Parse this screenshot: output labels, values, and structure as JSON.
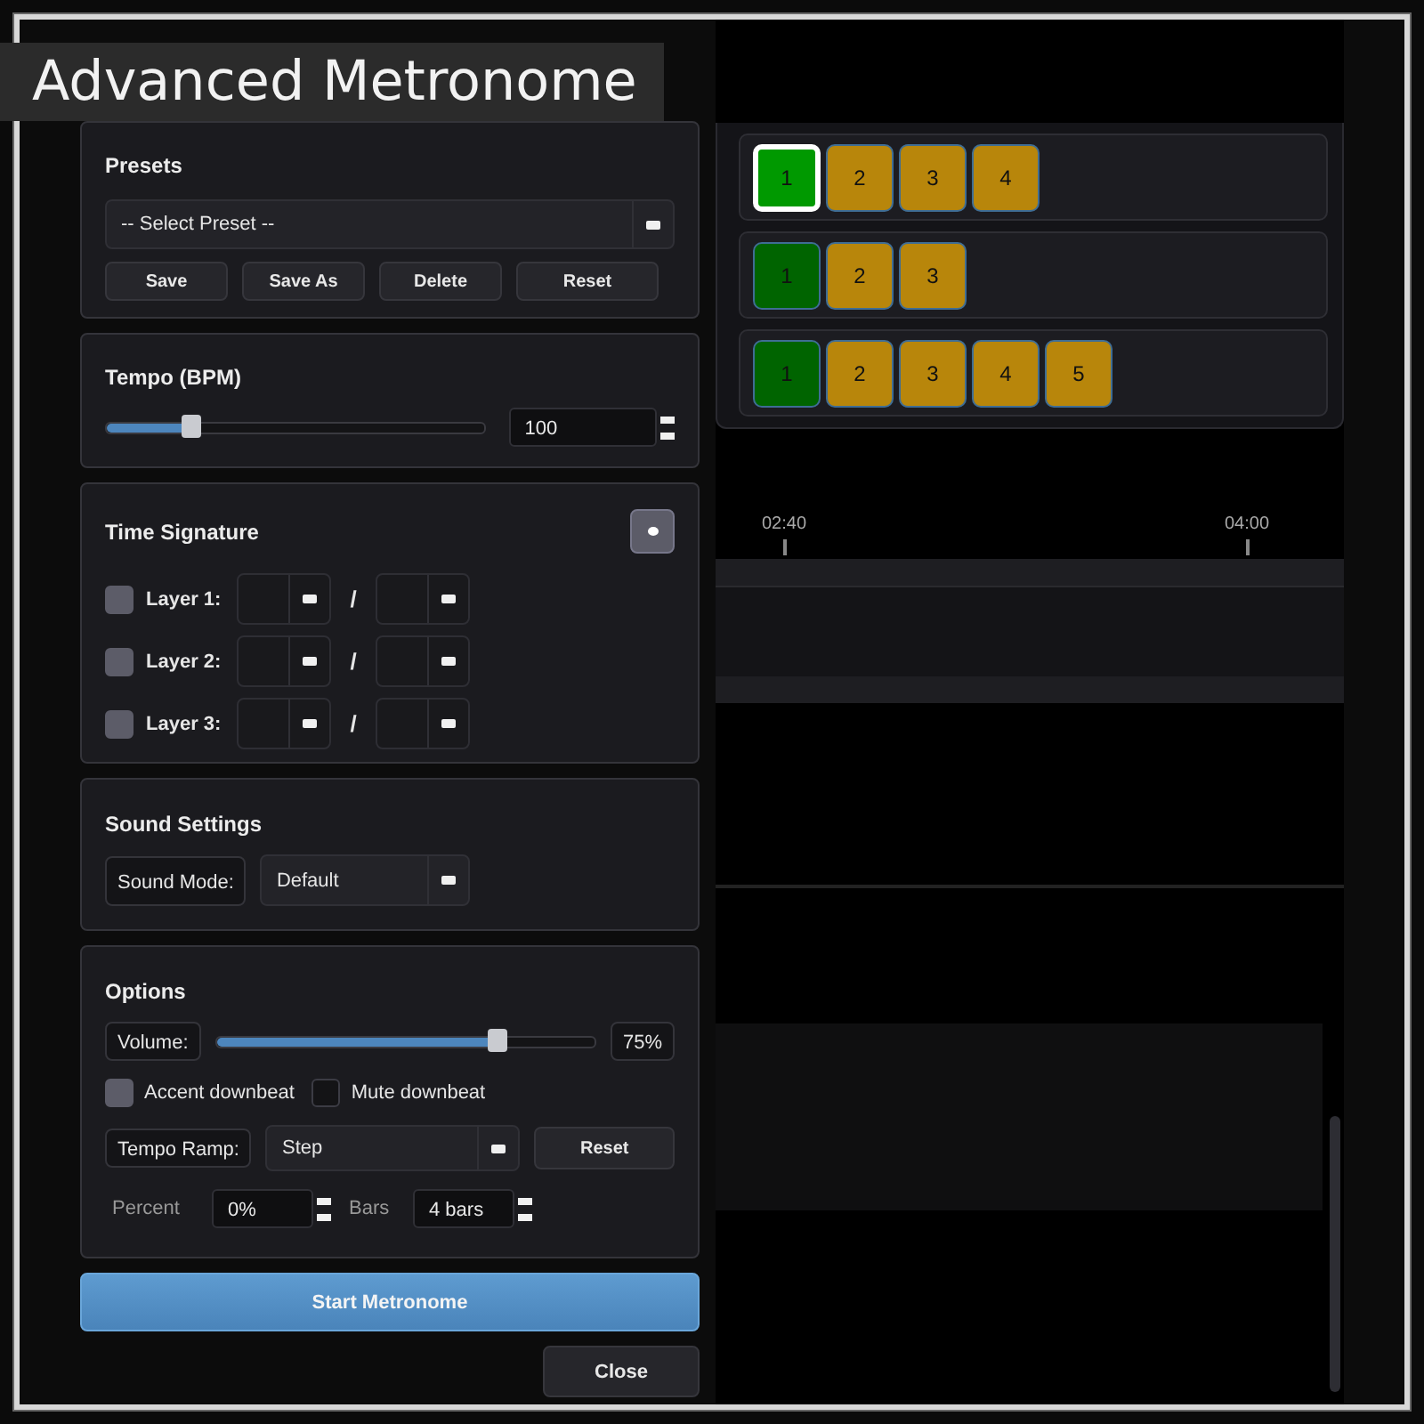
{
  "title": "Advanced Metronome",
  "presets": {
    "heading": "Presets",
    "select_value": "-- Select Preset --",
    "buttons": [
      "Save",
      "Save As",
      "Delete",
      "Reset"
    ]
  },
  "tempo": {
    "heading": "Tempo (BPM)",
    "level": 0.22,
    "value": "100"
  },
  "time_signature": {
    "heading": "Time Signature",
    "layers": [
      {
        "label": "Layer 1:",
        "checked": true
      },
      {
        "label": "Layer 2:",
        "checked": true
      },
      {
        "label": "Layer 3:",
        "checked": true
      }
    ],
    "separator": "/"
  },
  "sound": {
    "heading": "Sound Settings",
    "mode_label": "Sound Mode:",
    "mode_value": "Default"
  },
  "options": {
    "heading": "Options",
    "volume_label": "Volume:",
    "level": 0.74,
    "volume_reading": "75%",
    "checkboxes": [
      {
        "label": "Accent downbeat",
        "checked": true
      },
      {
        "label": "Mute downbeat",
        "checked": false
      }
    ],
    "ramp_label": "Tempo Ramp:",
    "ramp_value": "Step",
    "ramp_reset": "Reset",
    "percent_label": "Percent",
    "percent_value": "0%",
    "bars_label": "Bars",
    "bars_value": "4 bars"
  },
  "start_button": "Start Metronome",
  "close_button": "Close",
  "beat_rows": [
    {
      "beats": [
        {
          "label": "1",
          "kind": "accent",
          "selected": true
        },
        {
          "label": "2",
          "kind": "normal",
          "selected": false
        },
        {
          "label": "3",
          "kind": "normal",
          "selected": false
        },
        {
          "label": "4",
          "kind": "normal",
          "selected": false
        }
      ]
    },
    {
      "beats": [
        {
          "label": "1",
          "kind": "accent",
          "selected": false
        },
        {
          "label": "2",
          "kind": "normal",
          "selected": false
        },
        {
          "label": "3",
          "kind": "normal",
          "selected": false
        }
      ]
    },
    {
      "beats": [
        {
          "label": "1",
          "kind": "accent",
          "selected": false
        },
        {
          "label": "2",
          "kind": "normal",
          "selected": false
        },
        {
          "label": "3",
          "kind": "normal",
          "selected": false
        },
        {
          "label": "4",
          "kind": "normal",
          "selected": false
        },
        {
          "label": "5",
          "kind": "normal",
          "selected": false
        }
      ]
    }
  ],
  "timeline_ticks": [
    "02:40",
    "04:00"
  ]
}
